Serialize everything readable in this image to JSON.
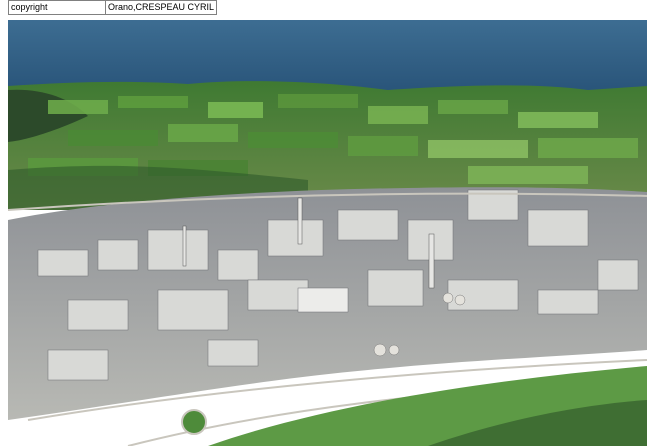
{
  "metadata": {
    "rows": [
      {
        "key": "copyright",
        "value": "Orano,CRESPEAU CYRIL"
      }
    ]
  },
  "photo": {
    "subject": "aerial-industrial-site",
    "colors": {
      "sea": "#2f5f86",
      "fields": "#4f8a3a",
      "buildings": "#c9ccd0",
      "grass": "#5d9a45"
    }
  }
}
